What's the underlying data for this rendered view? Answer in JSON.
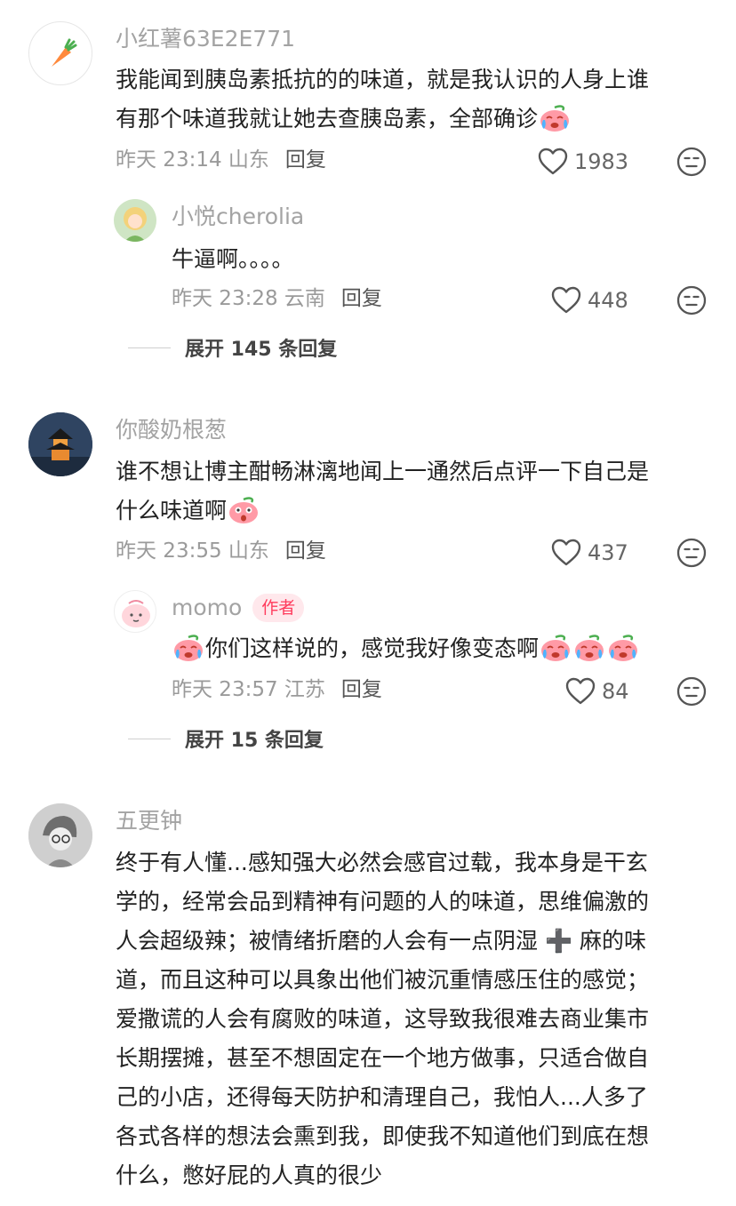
{
  "comments": [
    {
      "username": "小红薯63E2E771",
      "avatar": "carrot-avatar",
      "lines": [
        "我能闻到胰岛素抵抗的的味道，就是我认识的人身上谁",
        "有那个味道我就让她去查胰岛素，全部确诊"
      ],
      "emoji": "crying-emoji",
      "time": "昨天 23:14 山东",
      "reply": "回复",
      "likes": "1983",
      "replies": [
        {
          "username": "小悦cherolia",
          "avatar": "doll-avatar",
          "text": "牛逼啊。。。。",
          "time": "昨天 23:28 云南",
          "reply": "回复",
          "likes": "448"
        }
      ],
      "expand": "展开 145 条回复"
    },
    {
      "username": "你酸奶根葱",
      "avatar": "pagoda-avatar",
      "lines": [
        "谁不想让博主酣畅淋漓地闻上一通然后点评一下自己是",
        "什么味道啊"
      ],
      "emoji": "shocked-emoji",
      "time": "昨天 23:55 山东",
      "reply": "回复",
      "likes": "437",
      "replies": [
        {
          "username": "momo",
          "author_tag": "作者",
          "avatar": "peach-avatar",
          "text": "你们这样说的，感觉我好像变态啊",
          "time": "昨天 23:57 江苏",
          "reply": "回复",
          "likes": "84"
        }
      ],
      "expand": "展开 15 条回复"
    },
    {
      "username": "五更钟",
      "avatar": "sketch-avatar",
      "lines": [
        "终于有人懂...感知强大必然会感官过载，我本身是干玄",
        "学的，经常会品到精神有问题的人的味道，思维偏激的",
        "人会超级辣；被情绪折磨的人会有一点阴湿 ➕ 麻的味",
        "道，而且这种可以具象出他们被沉重情感压住的感觉；",
        "爱撒谎的人会有腐败的味道，这导致我很难去商业集市",
        "长期摆摊，甚至不想固定在一个地方做事，只适合做自",
        "己的小店，还得每天防护和清理自己，我怕人...人多了",
        "各式各样的想法会熏到我，即使我不知道他们到底在想",
        "什么，憋好屁的人真的很少"
      ]
    }
  ],
  "icons": {
    "like": "heart-outline-icon",
    "dislike": "meh-face-icon"
  },
  "colors": {
    "username": "#a3a3a3",
    "author_tag_bg": "#ffe8ec",
    "author_tag_text": "#ff3b5c"
  }
}
